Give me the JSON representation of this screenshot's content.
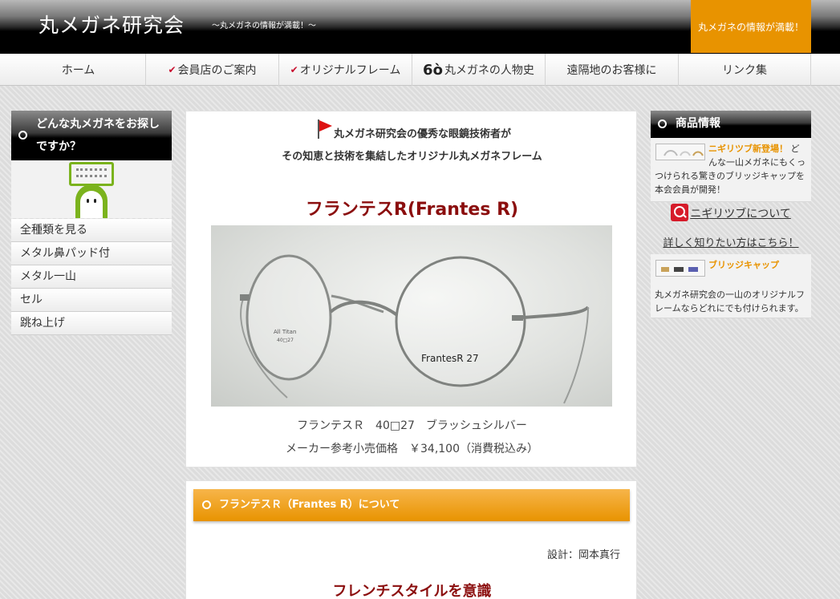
{
  "header": {
    "site_title": "丸メガネ研究会",
    "tagline": "～丸メガネの情報が満載！～",
    "badge": "丸メガネの情報が満載！"
  },
  "nav": {
    "items": [
      {
        "label": "ホーム"
      },
      {
        "label": "会員店のご案内"
      },
      {
        "label": "オリジナルフレーム"
      },
      {
        "label": "丸メガネの人物史"
      },
      {
        "label": "遠隔地のお客様に"
      },
      {
        "label": "リンク集"
      }
    ]
  },
  "left_sidebar": {
    "title": "どんな丸メガネをお探しですか？",
    "menu": [
      {
        "label": "全種類を見る"
      },
      {
        "label": "メタル鼻パッド付"
      },
      {
        "label": "メタル一山"
      },
      {
        "label": "セル"
      },
      {
        "label": "跳ね上げ"
      }
    ]
  },
  "main": {
    "intro_line1": "丸メガネ研究会の優秀な眼鏡技術者が",
    "intro_line2": "その知恵と技術を集結したオリジナル丸メガネフレーム",
    "product_title": "フランテスR(Frantes R)",
    "photo_text_model": "FrantesR 27",
    "photo_text_material": "All Titan",
    "photo_text_size": "40□27",
    "caption_line1": "フランテスＲ　40□27　ブラッシュシルバー",
    "caption_line2": "メーカー参考小売価格　￥34,100（消費税込み）"
  },
  "about": {
    "heading": "フランテスＲ（Frantes R）について",
    "designer": "設計：岡本真行",
    "section_title": "フレンチスタイルを意識"
  },
  "right_sidebar": {
    "title": "商品情報",
    "news1": {
      "title": "ニギリツブ新登場！",
      "body": "どんな一山メガネにもくっつけられる驚きのブリッジキャップを本会会員が開発！"
    },
    "link_text": "ニギリツブについて",
    "link_sub": "詳しく知りたい方はこちら！",
    "news2": {
      "title": "ブリッジキャップ",
      "body": "丸メガネ研究会の一山のオリジナルフレームならどれにでも付けられます。"
    }
  },
  "colors": {
    "accent_orange": "#e89300",
    "title_red": "#8b0e0e",
    "header_black": "#000000"
  }
}
